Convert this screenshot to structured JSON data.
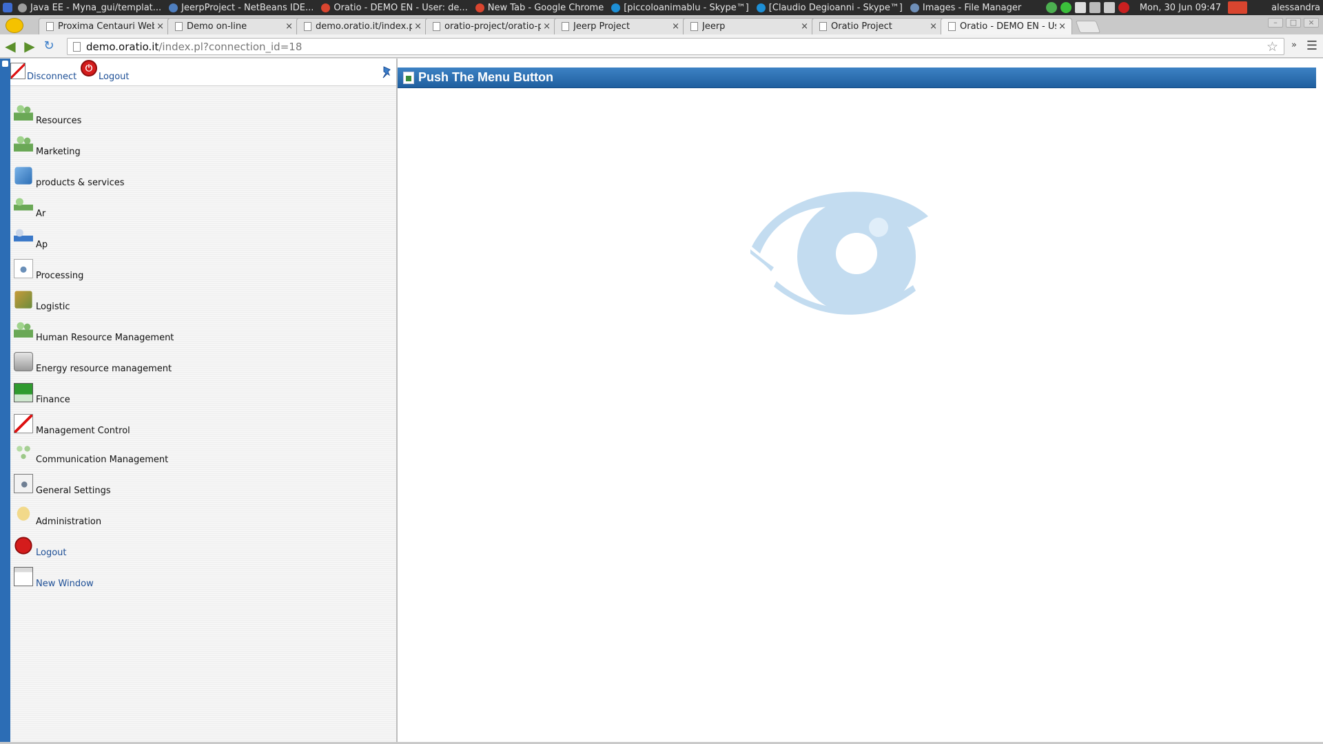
{
  "taskbar": {
    "tasks": [
      {
        "label": "Java EE - Myna_gui/templat...",
        "color": "#9d9d9d"
      },
      {
        "label": "JeerpProject - NetBeans IDE...",
        "color": "#4f7fc0"
      },
      {
        "label": "Oratio - DEMO EN - User: de...",
        "color": "#d9452f"
      },
      {
        "label": "New Tab - Google Chrome",
        "color": "#d9452f"
      },
      {
        "label": "[piccoloanimablu - Skype™]",
        "color": "#1d8fd6"
      },
      {
        "label": "[Claudio Degioanni - Skype™]",
        "color": "#1d8fd6"
      },
      {
        "label": "Images - File Manager",
        "color": "#6f8fb8"
      }
    ],
    "clock": "Mon, 30 Jun  09:47",
    "user": "alessandra"
  },
  "browser": {
    "tabs": [
      {
        "label": "Proxima Centauri Webn",
        "active": false
      },
      {
        "label": "Demo on-line",
        "active": false
      },
      {
        "label": "demo.oratio.it/index.pl",
        "active": false
      },
      {
        "label": "oratio-project/oratio-pr",
        "active": false
      },
      {
        "label": "Jeerp Project",
        "active": false
      },
      {
        "label": "Jeerp",
        "active": false
      },
      {
        "label": "Oratio Project",
        "active": false
      },
      {
        "label": "Oratio - DEMO EN - User",
        "active": true
      }
    ],
    "close_glyph": "×",
    "url_host": "demo.oratio.it",
    "url_path": "/index.pl?connection_id=18"
  },
  "sidebar": {
    "disconnect_label": "Disconnect",
    "logout_label": "Logout",
    "items": [
      {
        "label": "Resources",
        "icon": "ic-people",
        "name": "resources"
      },
      {
        "label": "Marketing",
        "icon": "ic-people",
        "name": "marketing"
      },
      {
        "label": "products & services",
        "icon": "ic-cube",
        "name": "products-services"
      },
      {
        "label": "Ar",
        "icon": "ic-ar",
        "name": "ar"
      },
      {
        "label": "Ap",
        "icon": "ic-ap",
        "name": "ap"
      },
      {
        "label": "Processing",
        "icon": "ic-processing",
        "name": "processing"
      },
      {
        "label": "Logistic",
        "icon": "ic-logistic",
        "name": "logistic"
      },
      {
        "label": "Human Resource Management",
        "icon": "ic-people",
        "name": "human-resource-management"
      },
      {
        "label": "Energy resource management",
        "icon": "ic-energy",
        "name": "energy-resource-management"
      },
      {
        "label": "Finance",
        "icon": "ic-finance",
        "name": "finance"
      },
      {
        "label": "Management Control",
        "icon": "ic-mgmt",
        "name": "management-control"
      },
      {
        "label": "Communication Management",
        "icon": "ic-comm",
        "name": "communication-management"
      },
      {
        "label": "General Settings",
        "icon": "ic-settings",
        "name": "general-settings"
      },
      {
        "label": "Administration",
        "icon": "ic-admin",
        "name": "administration"
      },
      {
        "label": "Logout",
        "icon": "ic-power-sm",
        "name": "logout",
        "link": true
      },
      {
        "label": "New Window",
        "icon": "ic-newwin",
        "name": "new-window",
        "link": true
      }
    ]
  },
  "main": {
    "title": "Push The Menu Button"
  },
  "colors": {
    "header_blue": "#2c6db5",
    "logo_blue": "#c3dcf0",
    "link_blue": "#1d4f96"
  }
}
